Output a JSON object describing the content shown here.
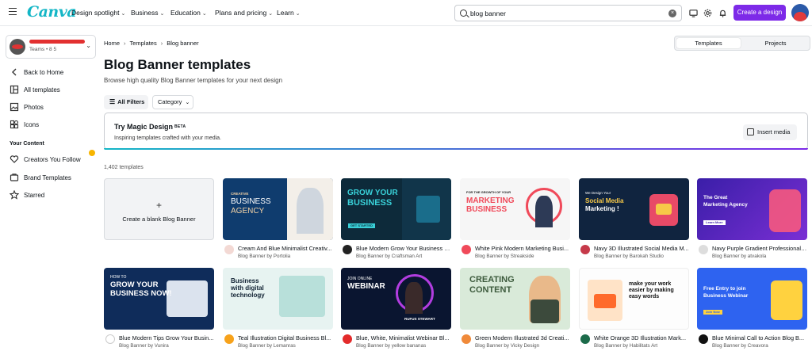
{
  "topbar": {
    "logo": "Canva",
    "nav": [
      {
        "label": "Design spotlight"
      },
      {
        "label": "Business"
      },
      {
        "label": "Education"
      },
      {
        "label": "Plans and pricing"
      },
      {
        "label": "Learn"
      }
    ],
    "search_value": "blog banner",
    "create_button": "Create a design"
  },
  "sidebar": {
    "team_sub": "Teams • 8 5",
    "back": "Back to Home",
    "items": [
      {
        "label": "All templates",
        "icon": "templates-icon"
      },
      {
        "label": "Photos",
        "icon": "photo-icon"
      },
      {
        "label": "Icons",
        "icon": "shapes-icon"
      }
    ],
    "section": "Your Content",
    "content_items": [
      {
        "label": "Creators You Follow",
        "icon": "heart-icon"
      },
      {
        "label": "Brand Templates",
        "icon": "brand-icon"
      },
      {
        "label": "Starred",
        "icon": "star-icon"
      }
    ]
  },
  "breadcrumb": [
    "Home",
    "Templates",
    "Blog banner"
  ],
  "toggle": {
    "active": "Templates",
    "inactive": "Projects"
  },
  "page_title": "Blog Banner templates",
  "page_subtitle": "Browse high quality Blog Banner templates for your next design",
  "filters": {
    "all": "All Filters",
    "category": "Category"
  },
  "magic": {
    "title": "Try Magic Design",
    "badge": "BETA",
    "description": "Inspiring templates crafted with your media.",
    "button": "Insert media"
  },
  "count": "1,402 templates",
  "blank_card": {
    "plus": "+",
    "label": "Create a blank Blog Banner"
  },
  "cards": [
    {
      "title": "Cream And Blue Minimalist Creativ...",
      "by": "Blog Banner by Portolia",
      "line1": "CREATIVE",
      "line2": "BUSINESS",
      "line3": "AGENCY"
    },
    {
      "title": "Blue Modern Grow Your Business B...",
      "by": "Blog Banner by Craftsman Art",
      "line1": "GROW YOUR",
      "line2": "BUSINESS",
      "line3": "GET STARTED"
    },
    {
      "title": "White Pink Modern Marketing Busi...",
      "by": "Blog Banner by Streakside",
      "line1": "FOR THE GROWTH OF YOUR",
      "line2": "MARKETING",
      "line3": "BUSINESS"
    },
    {
      "title": "Navy 3D Illustrated Social Media M...",
      "by": "Blog Banner by Barokah Studio",
      "line1": "We Design Your",
      "line2": "Social Media",
      "line3": "Marketing !"
    },
    {
      "title": "Navy Purple Gradient Professional ...",
      "by": "Blog Banner by atvakola",
      "line1": "The Great",
      "line2": "Marketing Agency",
      "line3": "Learn More"
    },
    {
      "title": "Blue Modern Tips Grow Your Busin...",
      "by": "Blog Banner by Vunira",
      "line1": "HOW TO",
      "line2": "GROW YOUR",
      "line3": "BUSINESS NOW!"
    },
    {
      "title": "Teal Illustration Digital Business Bl...",
      "by": "Blog Banner by Lemanras",
      "line1": "Business",
      "line2": "with digital",
      "line3": "technology"
    },
    {
      "title": "Blue, White, Minimalist Webinar Bl...",
      "by": "Blog Banner by yellow bananas",
      "line1": "JOIN ONLINE",
      "line2": "WEBINAR",
      "line3": "RUFUS STEWART"
    },
    {
      "title": "Green Modern Illustrated 3d Creati...",
      "by": "Blog Banner by Vicky Design",
      "line1": "CREATING",
      "line2": "CONTENT",
      "line3": ""
    },
    {
      "title": "White Orange 3D Illustration Mark...",
      "by": "Blog Banner by Habilitats Art",
      "line1": "make your work",
      "line2": "easier by making",
      "line3": "easy words"
    },
    {
      "title": "Blue Minimal Call to Action Blog B...",
      "by": "Blog Banner by Creavora",
      "line1": "Free Entry to join",
      "line2": "Business Webinar",
      "line3": "Join Now"
    }
  ],
  "colors": {
    "accent": "#7d2ae8",
    "brand": "#13b6c6"
  }
}
